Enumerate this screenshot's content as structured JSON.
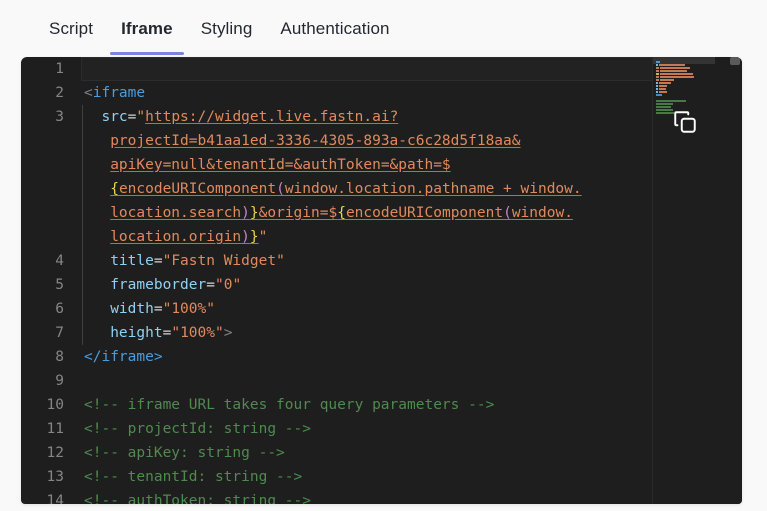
{
  "tabs": [
    {
      "label": "Script",
      "active": false
    },
    {
      "label": "Iframe",
      "active": true
    },
    {
      "label": "Styling",
      "active": false
    },
    {
      "label": "Authentication",
      "active": false
    }
  ],
  "colors": {
    "page_background": "#f9f9fa",
    "editor_background": "#1e1e1e",
    "active_tab_underline": "#7b85e0",
    "tag": "#4a9de0",
    "attribute": "#8fd1f5",
    "string": "#e08a5e",
    "comment": "#4f8a4f",
    "brace": "#e8d44d",
    "paren": "#c586c0",
    "gutter_text": "#858585"
  },
  "editor": {
    "language": "html",
    "copy_button_label": "copy-icon",
    "line_numbers": [
      "1",
      "2",
      "3",
      "4",
      "5",
      "6",
      "7",
      "8",
      "9",
      "10",
      "11",
      "12",
      "13",
      "14"
    ],
    "code_lines": [
      {
        "number": "1",
        "text": ""
      },
      {
        "number": "2",
        "text": "<iframe"
      },
      {
        "number": "3",
        "text": "  src=\"https://widget.live.fastn.ai?projectId=b41aa1ed-3336-4305-893a-c6c28d5f18aa&apiKey=null&tenantId=&authToken=&path=${encodeURIComponent(window.location.pathname + window.location.search)}&origin=${encodeURIComponent(window.location.origin)}\""
      },
      {
        "number": "4",
        "text": "  title=\"Fastn Widget\""
      },
      {
        "number": "5",
        "text": "  frameborder=\"0\""
      },
      {
        "number": "6",
        "text": "  width=\"100%\""
      },
      {
        "number": "7",
        "text": "  height=\"100%\">"
      },
      {
        "number": "8",
        "text": "</iframe>"
      },
      {
        "number": "9",
        "text": ""
      },
      {
        "number": "10",
        "text": "<!-- iframe URL takes four query parameters -->"
      },
      {
        "number": "11",
        "text": "<!-- projectId: string -->"
      },
      {
        "number": "12",
        "text": "<!-- apiKey: string -->"
      },
      {
        "number": "13",
        "text": "<!-- tenantId: string -->"
      },
      {
        "number": "14",
        "text": "<!-- authToken: string -->"
      }
    ],
    "tokens": {
      "tag_open_bracket": "<",
      "tag_name": "iframe",
      "tag_close": "</iframe>",
      "attr_src": "src",
      "attr_title": "title",
      "attr_frameborder": "frameborder",
      "attr_width": "width",
      "attr_height": "height",
      "equals": "=",
      "quote": "\"",
      "url_part_1": "https://widget.live.fastn.ai?",
      "url_part_2": "projectId=b41aa1ed-3336-4305-893a-c6c28d5f18aa&",
      "url_part_3": "apiKey=null&tenantId=&authToken=&path=$",
      "url_part_4_brace": "{",
      "url_part_4a": "encodeURIComponent",
      "url_part_4b": "(",
      "url_part_4c": "window.location.pathname + window.",
      "url_part_5a": "location.search",
      "url_part_5b": ")",
      "url_part_5c": "}",
      "url_part_5d": "&origin=$",
      "url_part_5e": "{",
      "url_part_5f": "encodeURIComponent",
      "url_part_5g": "(",
      "url_part_5h": "window.",
      "url_part_6a": "location.origin",
      "url_part_6b": ")",
      "url_part_6c": "}",
      "value_title": "Fastn Widget",
      "value_frameborder": "0",
      "value_width": "100%",
      "value_height": "100%",
      "gt": ">",
      "comment_10": "<!-- iframe URL takes four query parameters -->",
      "comment_11": "<!-- projectId: string -->",
      "comment_12": "<!-- apiKey: string -->",
      "comment_13": "<!-- tenantId: string -->",
      "comment_14": "<!-- authToken: string -->"
    }
  }
}
